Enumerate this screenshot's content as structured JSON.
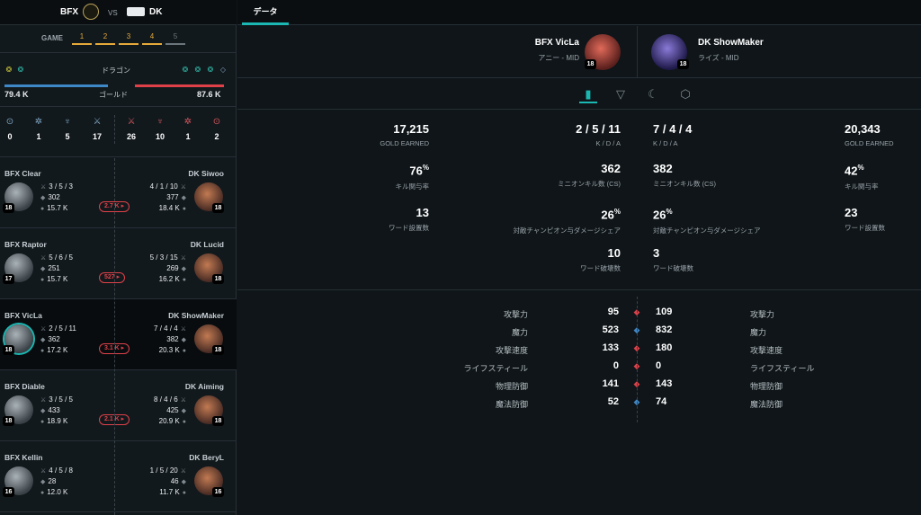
{
  "match": {
    "team_blue": "BFX",
    "vs": "VS",
    "team_red": "DK",
    "game_label": "GAME",
    "games": [
      "1",
      "2",
      "3",
      "4",
      "5"
    ],
    "dragon_label": "ドラゴン",
    "gold_label": "ゴールド",
    "gold_blue": "79.4 K",
    "gold_red": "87.6 K",
    "objectives_blue": [
      "0",
      "1",
      "5",
      "17"
    ],
    "objectives_red": [
      "26",
      "10",
      "1",
      "2"
    ],
    "blue_dragons": [
      "dragon-icon",
      "dragon-icon"
    ],
    "red_dragons": [
      "dragon-icon",
      "dragon-icon",
      "dragon-icon",
      "elder-icon"
    ]
  },
  "players": [
    {
      "blue_name": "BFX Clear",
      "blue_kda": "3 / 5 / 3",
      "blue_cs": "302",
      "blue_gold": "15.7 K",
      "blue_level": "18",
      "red_name": "DK Siwoo",
      "red_kda": "4 / 1 / 10",
      "red_cs": "377",
      "red_gold": "18.4 K",
      "red_level": "18",
      "diff": "2.7 K ▸"
    },
    {
      "blue_name": "BFX Raptor",
      "blue_kda": "5 / 6 / 5",
      "blue_cs": "251",
      "blue_gold": "15.7 K",
      "blue_level": "17",
      "red_name": "DK Lucid",
      "red_kda": "5 / 3 / 15",
      "red_cs": "269",
      "red_gold": "16.2 K",
      "red_level": "18",
      "diff": "527 ▸"
    },
    {
      "blue_name": "BFX VicLa",
      "blue_kda": "2 / 5 / 11",
      "blue_cs": "362",
      "blue_gold": "17.2 K",
      "blue_level": "18",
      "red_name": "DK ShowMaker",
      "red_kda": "7 / 4 / 4",
      "red_cs": "382",
      "red_gold": "20.3 K",
      "red_level": "18",
      "diff": "3.1 K ▸"
    },
    {
      "blue_name": "BFX Diable",
      "blue_kda": "3 / 5 / 5",
      "blue_cs": "433",
      "blue_gold": "18.9 K",
      "blue_level": "18",
      "red_name": "DK Aiming",
      "red_kda": "8 / 4 / 6",
      "red_cs": "425",
      "red_gold": "20.9 K",
      "red_level": "18",
      "diff": "2.1 K ▸"
    },
    {
      "blue_name": "BFX Kellin",
      "blue_kda": "4 / 5 / 8",
      "blue_cs": "28",
      "blue_gold": "12.0 K",
      "blue_level": "16",
      "red_name": "DK BeryL",
      "red_kda": "1 / 5 / 20",
      "red_cs": "46",
      "red_gold": "11.7 K",
      "red_level": "16",
      "diff": ""
    }
  ],
  "tab": {
    "label": "データ"
  },
  "compare": {
    "left_player": "BFX VicLa",
    "left_sub": "アニー - MID",
    "left_level": "18",
    "right_player": "DK ShowMaker",
    "right_sub": "ライズ - MID",
    "right_level": "18"
  },
  "stats": {
    "gold_label": "GOLD EARNED",
    "kda_label": "K / D / A",
    "left_gold": "17,215",
    "left_kda": "2 / 5 / 11",
    "right_kda": "7 / 4 / 4",
    "right_gold": "20,343",
    "left_kp": "76",
    "kp_label": "キル関与率",
    "minion_label": "ミニオンキル数 (CS)",
    "left_cs": "362",
    "right_cs": "382",
    "right_kp": "42",
    "left_wards": "13",
    "wards_label": "ワード設置数",
    "dmg_label": "対敵チャンピオン与ダメージシェア",
    "left_dmg": "26",
    "right_dmg": "26",
    "right_wards": "23",
    "wk_label": "ワード破壊数",
    "left_wk": "10",
    "right_wk": "3",
    "pct": "%"
  },
  "attributes": [
    {
      "label": "攻撃力",
      "left": "95",
      "right": "109",
      "icon": "sword-icon",
      "color": "#e04149"
    },
    {
      "label": "魔力",
      "left": "523",
      "right": "832",
      "icon": "wand-icon",
      "color": "#3f88c7"
    },
    {
      "label": "攻撃速度",
      "left": "133",
      "right": "180",
      "icon": "speed-icon",
      "color": "#e04149"
    },
    {
      "label": "ライフスティール",
      "left": "0",
      "right": "0",
      "icon": "lifesteal-icon",
      "color": "#e04149"
    },
    {
      "label": "物理防御",
      "left": "141",
      "right": "143",
      "icon": "armor-icon",
      "color": "#e04149"
    },
    {
      "label": "魔法防御",
      "left": "52",
      "right": "74",
      "icon": "magicres-icon",
      "color": "#3f88c7"
    }
  ]
}
